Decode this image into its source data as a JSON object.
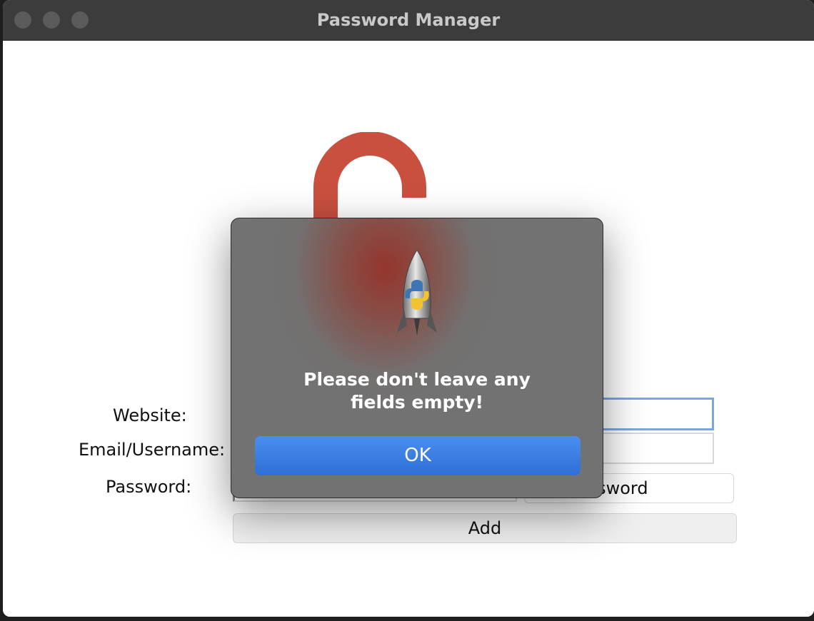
{
  "window": {
    "title": "Password Manager"
  },
  "form": {
    "website_label": "Website:",
    "email_label": "Email/Username:",
    "password_label": "Password:",
    "website_value": "",
    "email_value": "",
    "password_value": "",
    "generate_button_label": "ate Password",
    "add_button_label": "Add"
  },
  "dialog": {
    "message": "Please don't leave any fields empty!",
    "ok_label": "OK",
    "icon": "python-launcher-rocket-icon"
  },
  "logo": {
    "icon": "open-padlock-logo",
    "color": "#c9503f"
  },
  "colors": {
    "titlebar": "#3c3c3c",
    "ok_button": "#3478e0",
    "focus_ring": "#7aa7e4"
  }
}
